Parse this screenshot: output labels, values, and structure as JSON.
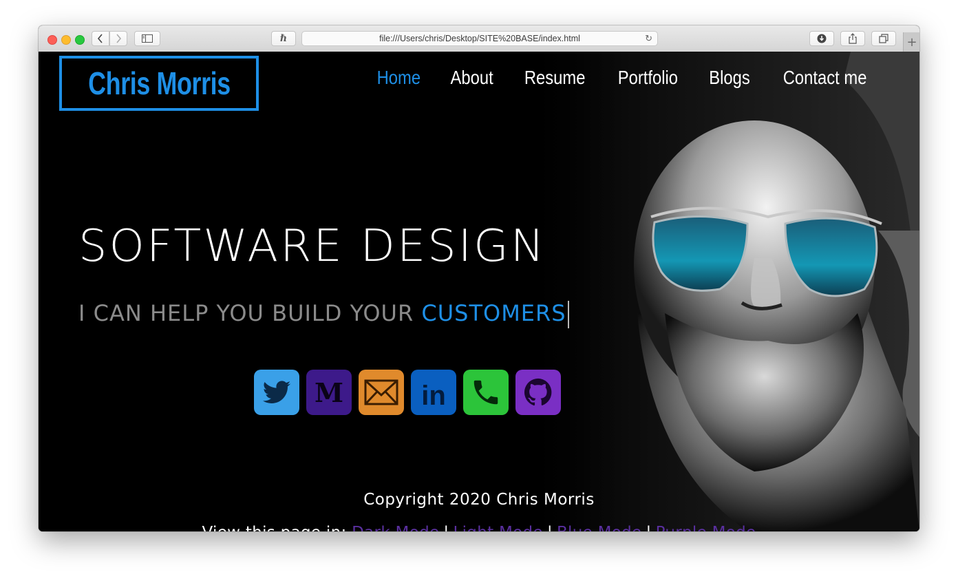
{
  "browser": {
    "url": "file:///Users/chris/Desktop/SITE%20BASE/index.html"
  },
  "site": {
    "logo": "Chris Morris",
    "nav": [
      {
        "label": "Home",
        "active": true
      },
      {
        "label": "About",
        "active": false
      },
      {
        "label": "Resume",
        "active": false
      },
      {
        "label": "Portfolio",
        "active": false
      },
      {
        "label": "Blogs",
        "active": false
      },
      {
        "label": "Contact me",
        "active": false
      }
    ],
    "headline": "SOFTWARE DESIGN",
    "subline_prefix": "I CAN HELP YOU BUILD YOUR ",
    "subline_accent": "CUSTOMERS",
    "socials": [
      {
        "icon": "twitter-icon",
        "color": "#3aa0e8"
      },
      {
        "icon": "medium-icon",
        "color": "#3d1a8a"
      },
      {
        "icon": "email-icon",
        "color": "#e08a2c"
      },
      {
        "icon": "linkedin-icon",
        "color": "#0a5fc0"
      },
      {
        "icon": "phone-icon",
        "color": "#2cc43a"
      },
      {
        "icon": "github-icon",
        "color": "#7a2fc4"
      }
    ],
    "copyright": "Copyright 2020 Chris Morris",
    "modes_prefix": "View this page in: ",
    "modes": [
      "Dark Mode",
      "Light Mode",
      "Blue Mode",
      "Purple Mode"
    ],
    "accent_color": "#1e8fe6",
    "link_color": "#5a2fa0"
  }
}
